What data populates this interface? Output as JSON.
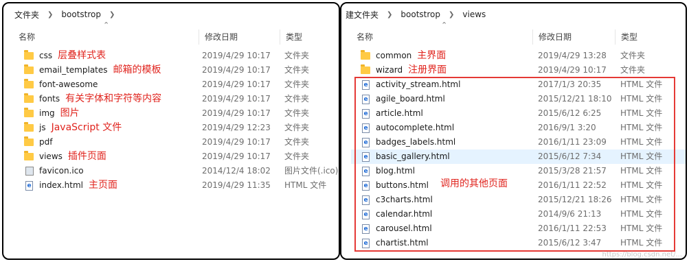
{
  "left": {
    "breadcrumb": [
      "文件夹",
      "bootstrop"
    ],
    "columns": {
      "name": "名称",
      "date": "修改日期",
      "type": "类型"
    },
    "rows": [
      {
        "icon": "folder",
        "name": "css",
        "date": "2019/4/29 10:17",
        "type": "文件夹",
        "note": "层叠样式表"
      },
      {
        "icon": "folder",
        "name": "email_templates",
        "date": "2019/4/29 10:17",
        "type": "文件夹",
        "note": "邮箱的模板"
      },
      {
        "icon": "folder",
        "name": "font-awesome",
        "date": "2019/4/29 10:17",
        "type": "文件夹",
        "note": ""
      },
      {
        "icon": "folder",
        "name": "fonts",
        "date": "2019/4/29 10:17",
        "type": "文件夹",
        "note": "有关字体和字符等内容"
      },
      {
        "icon": "folder",
        "name": "img",
        "date": "2019/4/29 10:17",
        "type": "文件夹",
        "note": "图片"
      },
      {
        "icon": "folder",
        "name": "js",
        "date": "2019/4/29 12:23",
        "type": "文件夹",
        "note": "JavaScript 文件"
      },
      {
        "icon": "folder",
        "name": "pdf",
        "date": "2019/4/29 10:17",
        "type": "文件夹",
        "note": ""
      },
      {
        "icon": "folder",
        "name": "views",
        "date": "2019/4/29 10:17",
        "type": "文件夹",
        "note": "插件页面"
      },
      {
        "icon": "ico",
        "name": "favicon.ico",
        "date": "2014/12/4 18:02",
        "type": "图片文件(.ico)",
        "note": ""
      },
      {
        "icon": "html",
        "name": "index.html",
        "date": "2019/4/29 11:35",
        "type": "HTML 文件",
        "note": "主页面"
      }
    ]
  },
  "right": {
    "breadcrumb": [
      "建文件夹",
      "bootstrop",
      "views"
    ],
    "columns": {
      "name": "名称",
      "date": "修改日期",
      "type": "类型"
    },
    "rows": [
      {
        "icon": "folder",
        "name": "common",
        "date": "2019/4/29 13:28",
        "type": "文件夹",
        "note": "主界面"
      },
      {
        "icon": "folder",
        "name": "wizard",
        "date": "2019/4/29 10:17",
        "type": "文件夹",
        "note": "注册界面"
      },
      {
        "icon": "html",
        "name": "activity_stream.html",
        "date": "2017/1/3 20:35",
        "type": "HTML 文件",
        "note": ""
      },
      {
        "icon": "html",
        "name": "agile_board.html",
        "date": "2015/12/21 18:10",
        "type": "HTML 文件",
        "note": ""
      },
      {
        "icon": "html",
        "name": "article.html",
        "date": "2015/6/12 6:25",
        "type": "HTML 文件",
        "note": ""
      },
      {
        "icon": "html",
        "name": "autocomplete.html",
        "date": "2016/9/1 3:20",
        "type": "HTML 文件",
        "note": ""
      },
      {
        "icon": "html",
        "name": "badges_labels.html",
        "date": "2016/1/11 23:09",
        "type": "HTML 文件",
        "note": ""
      },
      {
        "icon": "html",
        "name": "basic_gallery.html",
        "date": "2015/6/12 7:34",
        "type": "HTML 文件",
        "note": ""
      },
      {
        "icon": "html",
        "name": "blog.html",
        "date": "2015/3/28 21:57",
        "type": "HTML 文件",
        "note": ""
      },
      {
        "icon": "html",
        "name": "buttons.html",
        "date": "2016/1/11 22:52",
        "type": "HTML 文件",
        "note": ""
      },
      {
        "icon": "html",
        "name": "c3charts.html",
        "date": "2015/12/21 18:26",
        "type": "HTML 文件",
        "note": ""
      },
      {
        "icon": "html",
        "name": "calendar.html",
        "date": "2014/9/6 21:13",
        "type": "HTML 文件",
        "note": ""
      },
      {
        "icon": "html",
        "name": "carousel.html",
        "date": "2016/1/11 22:53",
        "type": "HTML 文件",
        "note": ""
      },
      {
        "icon": "html",
        "name": "chartist.html",
        "date": "2015/6/12 3:47",
        "type": "HTML 文件",
        "note": ""
      }
    ],
    "selected_row": "basic_gallery.html",
    "group_note": "调用的其他页面"
  },
  "watermark": "https://blog.csdn.net/...",
  "colors": {
    "annotation": "#e0241e",
    "folder": "#ffca45",
    "selection": "#e5f3ff",
    "frame": "#000000"
  }
}
